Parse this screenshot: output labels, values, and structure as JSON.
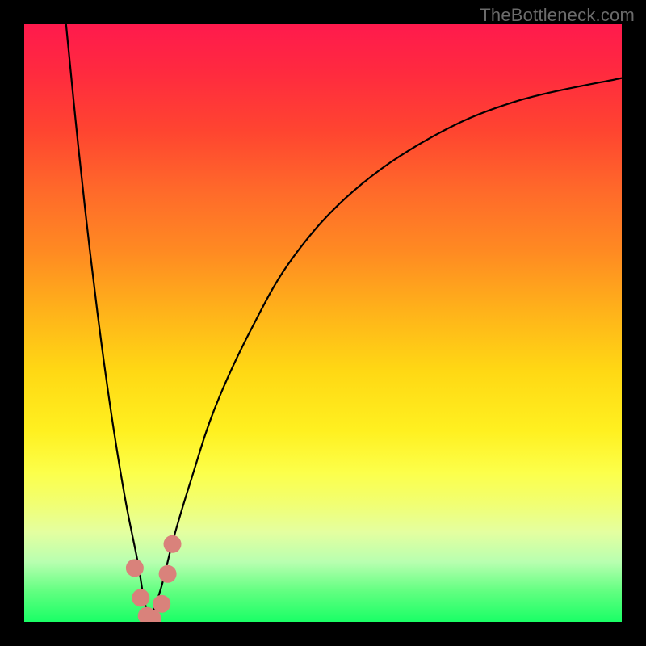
{
  "watermark": "TheBottleneck.com",
  "colors": {
    "frame": "#000000",
    "curve": "#000000",
    "marker": "#d9827b",
    "gradient_top": "#ff1a4d",
    "gradient_bottom": "#1aff66"
  },
  "chart_data": {
    "type": "line",
    "title": "",
    "xlabel": "",
    "ylabel": "",
    "xlim": [
      0,
      100
    ],
    "ylim": [
      0,
      100
    ],
    "grid": false,
    "legend": false,
    "note": "Axes have no tick labels; values are relative percentages of the plot area. y=0 is the bottom (green, best), y=100 is the top (red, worst). The minimum of the V-curve sits near x≈21.",
    "series": [
      {
        "name": "left-branch",
        "x": [
          7,
          9,
          11,
          13,
          15,
          17,
          19,
          20,
          21
        ],
        "y": [
          100,
          80,
          62,
          46,
          32,
          20,
          10,
          4,
          0
        ]
      },
      {
        "name": "right-branch",
        "x": [
          21,
          23,
          25,
          28,
          32,
          38,
          45,
          55,
          68,
          82,
          100
        ],
        "y": [
          0,
          6,
          14,
          24,
          36,
          49,
          61,
          72,
          81,
          87,
          91
        ]
      }
    ],
    "markers": {
      "name": "highlight-points",
      "points": [
        {
          "x": 18.5,
          "y": 9
        },
        {
          "x": 19.5,
          "y": 4
        },
        {
          "x": 20.5,
          "y": 1
        },
        {
          "x": 21.5,
          "y": 0.5
        },
        {
          "x": 23.0,
          "y": 3
        },
        {
          "x": 24.0,
          "y": 8
        },
        {
          "x": 24.8,
          "y": 13
        }
      ]
    }
  }
}
